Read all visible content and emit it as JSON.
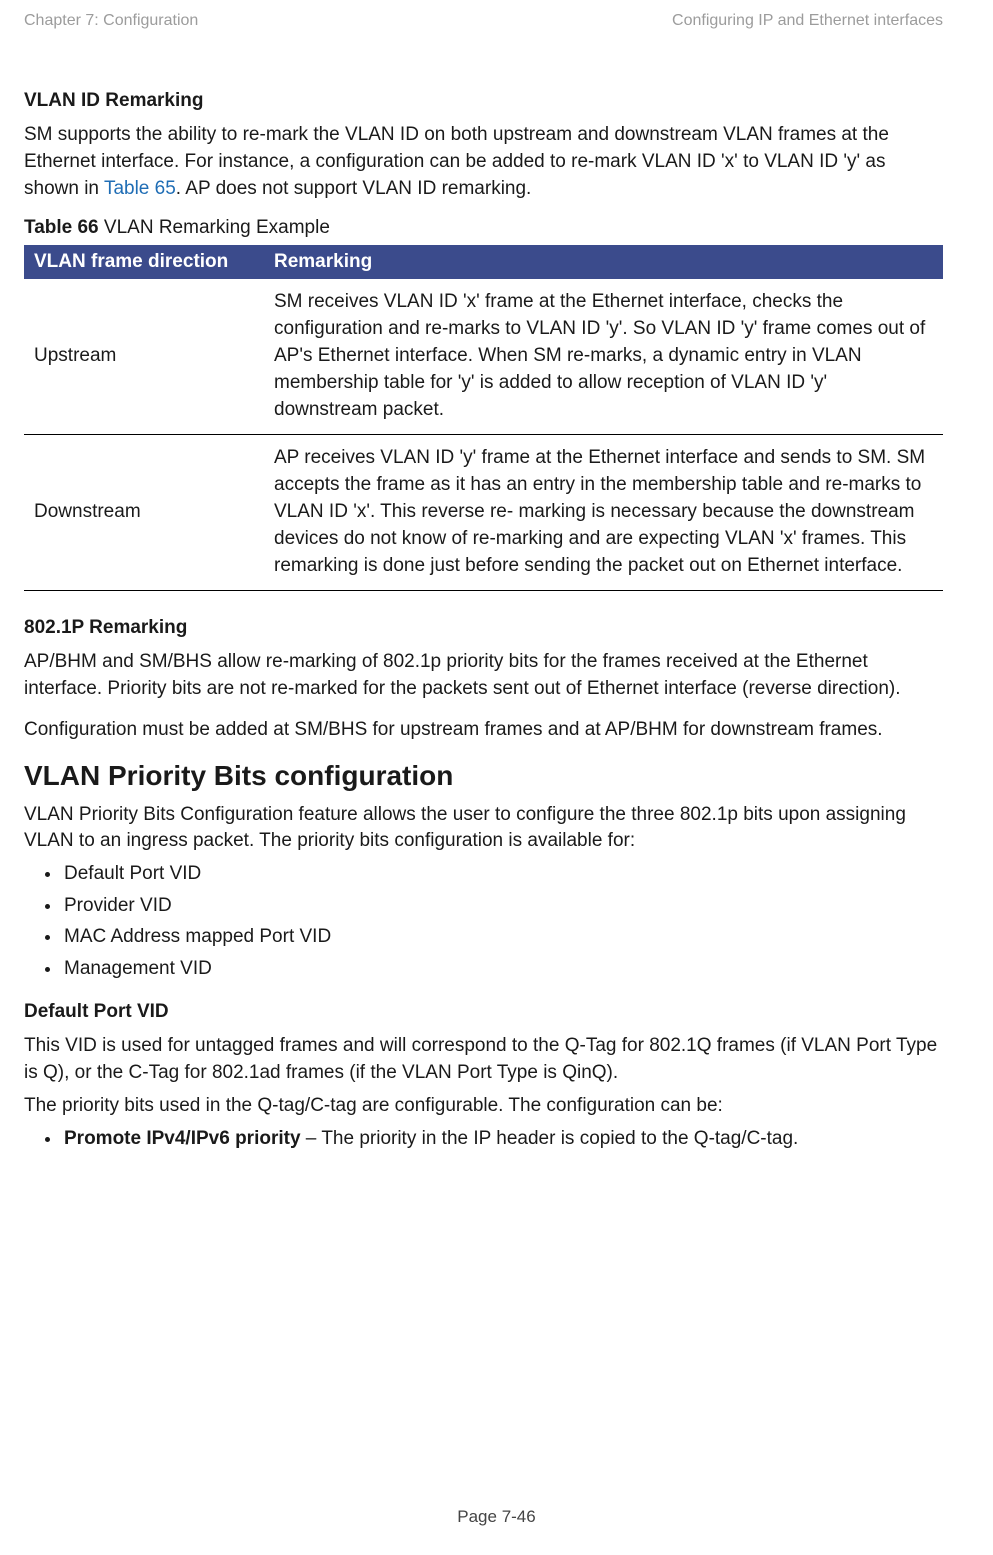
{
  "header": {
    "left": "Chapter 7:  Configuration",
    "right": "Configuring IP and Ethernet interfaces"
  },
  "section_vlan_id": {
    "title": "VLAN ID Remarking",
    "para_parts": {
      "a": "SM supports the ability to re-mark the VLAN ID on both upstream and downstream VLAN frames at the Ethernet interface. For instance, a configuration can be added to re-mark VLAN ID 'x' to VLAN ID 'y' as shown in ",
      "link": "Table 65",
      "b": ". AP does not support VLAN ID remarking."
    }
  },
  "table66": {
    "caption_bold": "Table 66",
    "caption_rest": " VLAN Remarking Example",
    "head": {
      "c1": "VLAN frame direction",
      "c2": "Remarking"
    },
    "rows": [
      {
        "direction": "Upstream",
        "remarking": "SM receives VLAN ID 'x' frame at the Ethernet interface, checks the configuration and re-marks to VLAN ID 'y'. So VLAN ID 'y' frame comes out of AP's Ethernet interface. When SM re-marks, a dynamic entry in VLAN membership table for 'y' is added to allow reception of VLAN ID 'y' downstream packet."
      },
      {
        "direction": "Downstream",
        "remarking": "AP receives VLAN ID 'y' frame at the Ethernet interface and sends to SM. SM accepts the frame as it has an entry in the membership table and re-marks to VLAN ID 'x'. This reverse re- marking is necessary because the downstream devices do not know of re-marking and are expecting VLAN 'x' frames. This remarking is done just before sending the packet out on Ethernet interface."
      }
    ]
  },
  "section_8021p": {
    "title": "802.1P Remarking",
    "p1": "AP/BHM and SM/BHS allow re-marking of 802.1p priority bits for the frames received at the Ethernet interface. Priority bits are not re-marked for the packets sent out of Ethernet interface (reverse direction).",
    "p2": "Configuration must be added at SM/BHS for upstream frames and at AP/BHM for downstream frames."
  },
  "section_priority_bits": {
    "title": "VLAN Priority Bits configuration",
    "intro": "VLAN Priority Bits Configuration feature allows the user to configure the three 802.1p bits upon assigning VLAN to an ingress packet. The priority bits configuration is available for:",
    "items": [
      "Default Port VID",
      "Provider VID",
      "MAC Address mapped Port VID",
      "Management VID"
    ]
  },
  "section_default_port_vid": {
    "title": "Default Port VID",
    "p1": "This VID is used for untagged frames and will correspond to the Q-Tag for 802.1Q frames (if VLAN  Port Type is Q), or the C-Tag for 802.1ad frames (if the VLAN Port Type is QinQ).",
    "p2": "The priority bits used in the Q-tag/C-tag are configurable. The configuration can be:",
    "bullet_bold": "Promote IPv4/IPv6 priority",
    "bullet_rest": " – The priority in the IP header is copied to the Q-tag/C-tag."
  },
  "footer": "Page 7-46"
}
